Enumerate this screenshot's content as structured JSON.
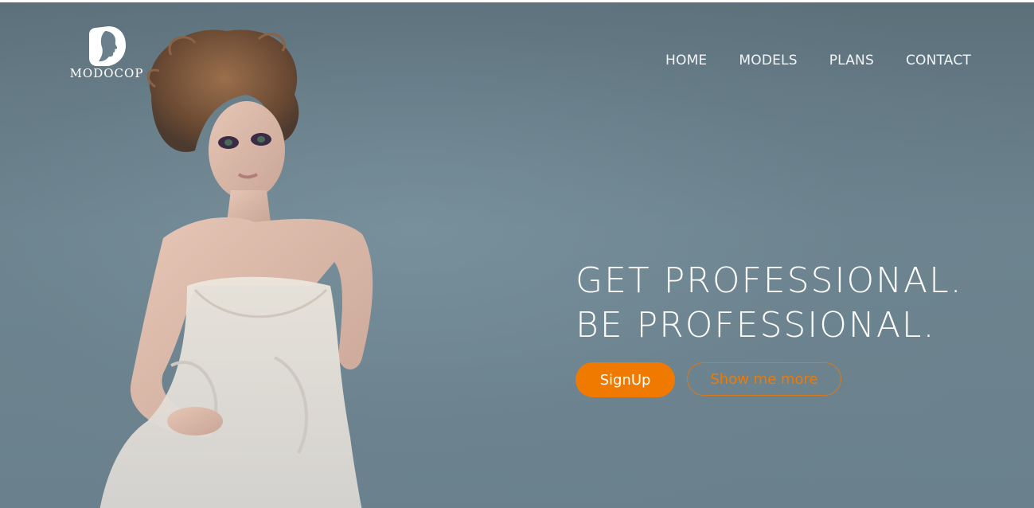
{
  "brand": {
    "name": "MODOCOP",
    "logo_icon": "face-profile-icon"
  },
  "nav": {
    "items": [
      {
        "label": "HOME"
      },
      {
        "label": "MODELS"
      },
      {
        "label": "PLANS"
      },
      {
        "label": "CONTACT"
      }
    ]
  },
  "hero": {
    "line1": "GET PROFESSIONAL.",
    "line2": "BE PROFESSIONAL.",
    "primary_button": "SignUp",
    "secondary_button": "Show me more",
    "image": "fashion-model-photo"
  },
  "colors": {
    "accent": "#f07a00",
    "background": "#6a818d",
    "text": "#ffffff"
  }
}
